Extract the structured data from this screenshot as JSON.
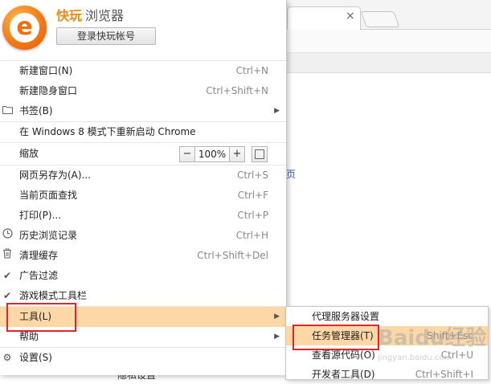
{
  "background": {
    "tab_close_glyph": "×",
    "link_text": "页",
    "bottom_text": "隐私设置"
  },
  "header": {
    "logo_letter": "e",
    "brand_primary": "快玩",
    "brand_secondary": "浏览器",
    "login_button": "登录快玩帐号"
  },
  "menu": {
    "new_window": {
      "label": "新建窗口(N)",
      "shortcut": "Ctrl+N"
    },
    "incognito": {
      "label": "新建隐身窗口",
      "shortcut": "Ctrl+Shift+N"
    },
    "bookmarks": {
      "label": "书签(B)"
    },
    "restart_win8": {
      "label": "在 Windows 8 模式下重新启动 Chrome"
    },
    "zoom": {
      "label": "缩放",
      "minus": "−",
      "value": "100%",
      "plus": "+"
    },
    "save_as": {
      "label": "网页另存为(A)...",
      "shortcut": "Ctrl+S"
    },
    "find": {
      "label": "当前页面查找",
      "shortcut": "Ctrl+F"
    },
    "print": {
      "label": "打印(P)...",
      "shortcut": "Ctrl+P"
    },
    "history": {
      "label": "历史浏览记录",
      "shortcut": "Ctrl+H"
    },
    "clear_cache": {
      "label": "清理缓存",
      "shortcut": "Ctrl+Shift+Del"
    },
    "ad_filter": {
      "label": "广告过滤",
      "checked": true
    },
    "game_toolbar": {
      "label": "游戏模式工具栏",
      "checked": true
    },
    "tools": {
      "label": "工具(L)"
    },
    "help": {
      "label": "帮助"
    },
    "settings": {
      "label": "设置(S)"
    }
  },
  "submenu": {
    "proxy": {
      "label": "代理服务器设置"
    },
    "task_manager": {
      "label": "任务管理器(T)",
      "shortcut": "Shift+Esc"
    },
    "view_source": {
      "label": "查看源代码(O)",
      "shortcut": "Ctrl+U"
    },
    "dev_tools": {
      "label": "开发者工具(D)",
      "shortcut": "Ctrl+Shift+I"
    }
  },
  "watermark": {
    "text": "Baidu经验",
    "sub": "jingyan.baidu.com"
  },
  "colors": {
    "highlight": "#fcd8a6",
    "callout": "#e1252a",
    "brand": "#f08a12"
  }
}
